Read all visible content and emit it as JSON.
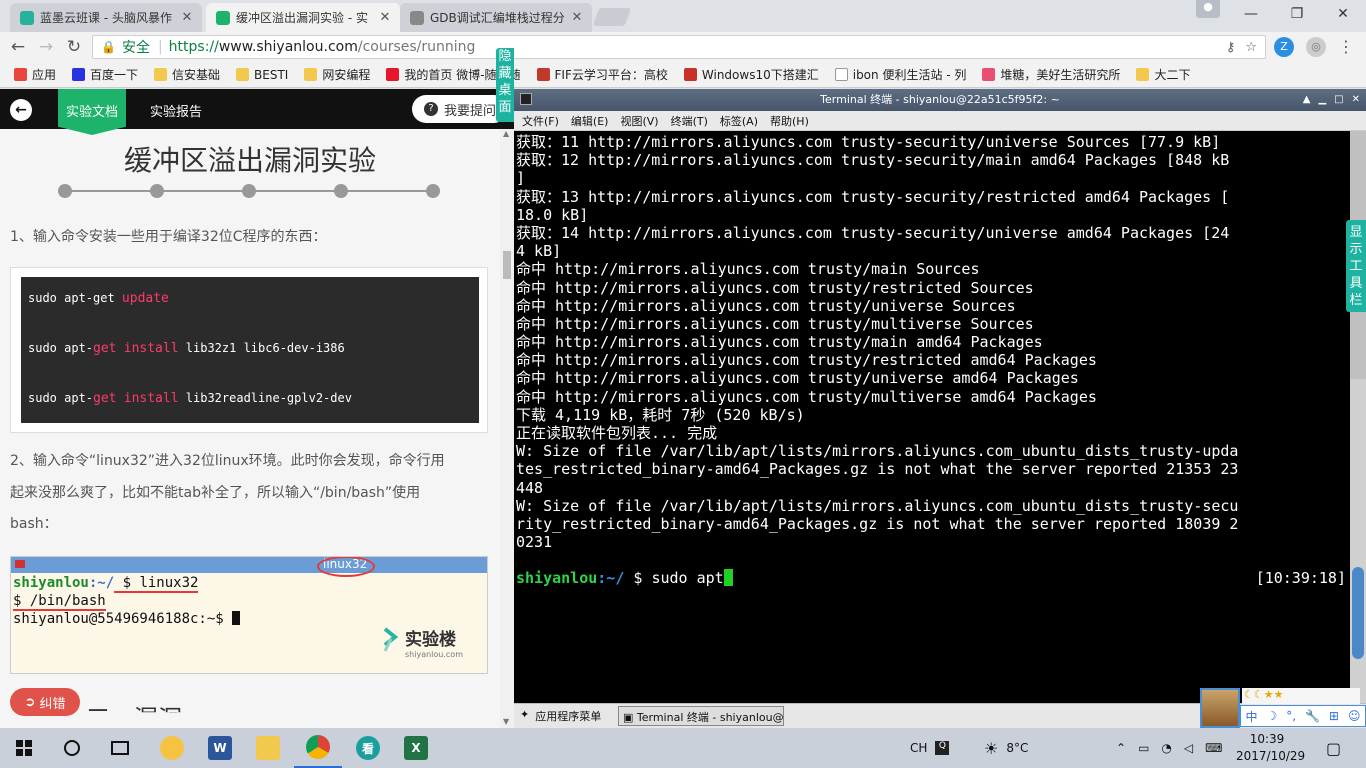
{
  "browser": {
    "tabs": [
      {
        "title": "蓝墨云班课 - 头脑风暴作",
        "favicon_color": "#27b39b"
      },
      {
        "title": "缓冲区溢出漏洞实验 - 实",
        "favicon_color": "#1db36b"
      },
      {
        "title": "GDB调试汇编堆栈过程分",
        "favicon_color": "#888888"
      }
    ],
    "close_glyph": "✕",
    "window_controls": {
      "minimize": "—",
      "maximize": "❐",
      "close": "✕"
    },
    "address": {
      "secure_label": "安全",
      "url_scheme": "https://",
      "url_host": "www.shiyanlou.com",
      "url_path": "/courses/running"
    },
    "bookmarks": [
      {
        "label": "应用",
        "icon": "apps-icon"
      },
      {
        "label": "百度一下",
        "icon": "baidu-icon"
      },
      {
        "label": "信安基础",
        "icon": "folder-icon"
      },
      {
        "label": "BESTI",
        "icon": "folder-icon"
      },
      {
        "label": "网安编程",
        "icon": "folder-icon"
      },
      {
        "label": "我的首页 微博-随时随",
        "icon": "weibo-icon"
      },
      {
        "label": "FIF云学习平台：高校",
        "icon": "fif-icon"
      },
      {
        "label": "Windows10下搭建汇",
        "icon": "csdn-icon"
      },
      {
        "label": "ibon 便利生活站 - 列",
        "icon": "page-icon"
      },
      {
        "label": "堆糖，美好生活研究所",
        "icon": "duitang-icon"
      },
      {
        "label": "大二下",
        "icon": "folder-icon"
      }
    ]
  },
  "doc": {
    "tab_doc": "实验文档",
    "tab_report": "实验报告",
    "ask_button": "我要提问",
    "title": "缓冲区溢出漏洞实验",
    "progress_steps": 5,
    "step1": "1、输入命令安装一些用于编译32位C程序的东西：",
    "code_lines": [
      {
        "pre": "sudo apt-get ",
        "kw1": "update",
        "mid": "",
        "kw2": "",
        "post": ""
      },
      {
        "pre": "sudo apt-",
        "kw1": "get",
        "mid": " ",
        "kw2": "install",
        "post": " lib32z1 libc6-dev-i386"
      },
      {
        "pre": "sudo apt-",
        "kw1": "get",
        "mid": " ",
        "kw2": "install",
        "post": " lib32readline-gplv2-dev"
      }
    ],
    "step2_lines": [
      "2、输入命令“linux32”进入32位linux环境。此时你会发现，命令行用",
      "起来没那么爽了，比如不能tab补全了，所以输入“/bin/bash”使用",
      "bash："
    ],
    "screenshot": {
      "tag": "linux32",
      "line1_user": "shiyanlou",
      "line1_path": ":~/",
      "line1_cmd": " $ linux32",
      "line2": "$ /bin/bash",
      "line3": "shiyanlou@55496946188c:~$ ",
      "logo_text": "实验楼",
      "logo_sub": "shiyanlou.com"
    },
    "hide_desktop": "隐藏桌面",
    "fix_button": "纠错",
    "cut_heading": "三、漏洞"
  },
  "terminal": {
    "title": "Terminal 终端 - shiyanlou@22a51c5f95f2: ~",
    "menu": [
      "文件(F)",
      "编辑(E)",
      "视图(V)",
      "终端(T)",
      "标签(A)",
      "帮助(H)"
    ],
    "lines": [
      "获取：11 http://mirrors.aliyuncs.com trusty-security/universe Sources [77.9 kB]",
      "获取：12 http://mirrors.aliyuncs.com trusty-security/main amd64 Packages [848 kB",
      "]",
      "获取：13 http://mirrors.aliyuncs.com trusty-security/restricted amd64 Packages [",
      "18.0 kB]",
      "获取：14 http://mirrors.aliyuncs.com trusty-security/universe amd64 Packages [24",
      "4 kB]",
      "命中 http://mirrors.aliyuncs.com trusty/main Sources",
      "命中 http://mirrors.aliyuncs.com trusty/restricted Sources",
      "命中 http://mirrors.aliyuncs.com trusty/universe Sources",
      "命中 http://mirrors.aliyuncs.com trusty/multiverse Sources",
      "命中 http://mirrors.aliyuncs.com trusty/main amd64 Packages",
      "命中 http://mirrors.aliyuncs.com trusty/restricted amd64 Packages",
      "命中 http://mirrors.aliyuncs.com trusty/universe amd64 Packages",
      "命中 http://mirrors.aliyuncs.com trusty/multiverse amd64 Packages",
      "下载 4,119 kB，耗时 7秒 (520 kB/s)",
      "正在读取软件包列表... 完成",
      "W: Size of file /var/lib/apt/lists/mirrors.aliyuncs.com_ubuntu_dists_trusty-upda",
      "tes_restricted_binary-amd64_Packages.gz is not what the server reported 21353 23",
      "448",
      "W: Size of file /var/lib/apt/lists/mirrors.aliyuncs.com_ubuntu_dists_trusty-secu",
      "rity_restricted_binary-amd64_Packages.gz is not what the server reported 18039 2",
      "0231"
    ],
    "prompt_user": "shiyanlou",
    "prompt_path": ":~/",
    "prompt_cmd": " $ sudo apt",
    "timestamp": "[10:39:18]",
    "toolbox_label": "显示工具栏",
    "vm_start": "应用程序菜单",
    "vm_task": "Terminal 终端 - shiyanlou@···"
  },
  "ime": {
    "stars": "☾☾★★",
    "items": [
      "中",
      "☽",
      "°,",
      "🔧",
      "⊞",
      "☺"
    ]
  },
  "taskbar": {
    "lang": "CH",
    "temperature": "8°C",
    "time": "10:39",
    "date": "2017/10/29"
  }
}
